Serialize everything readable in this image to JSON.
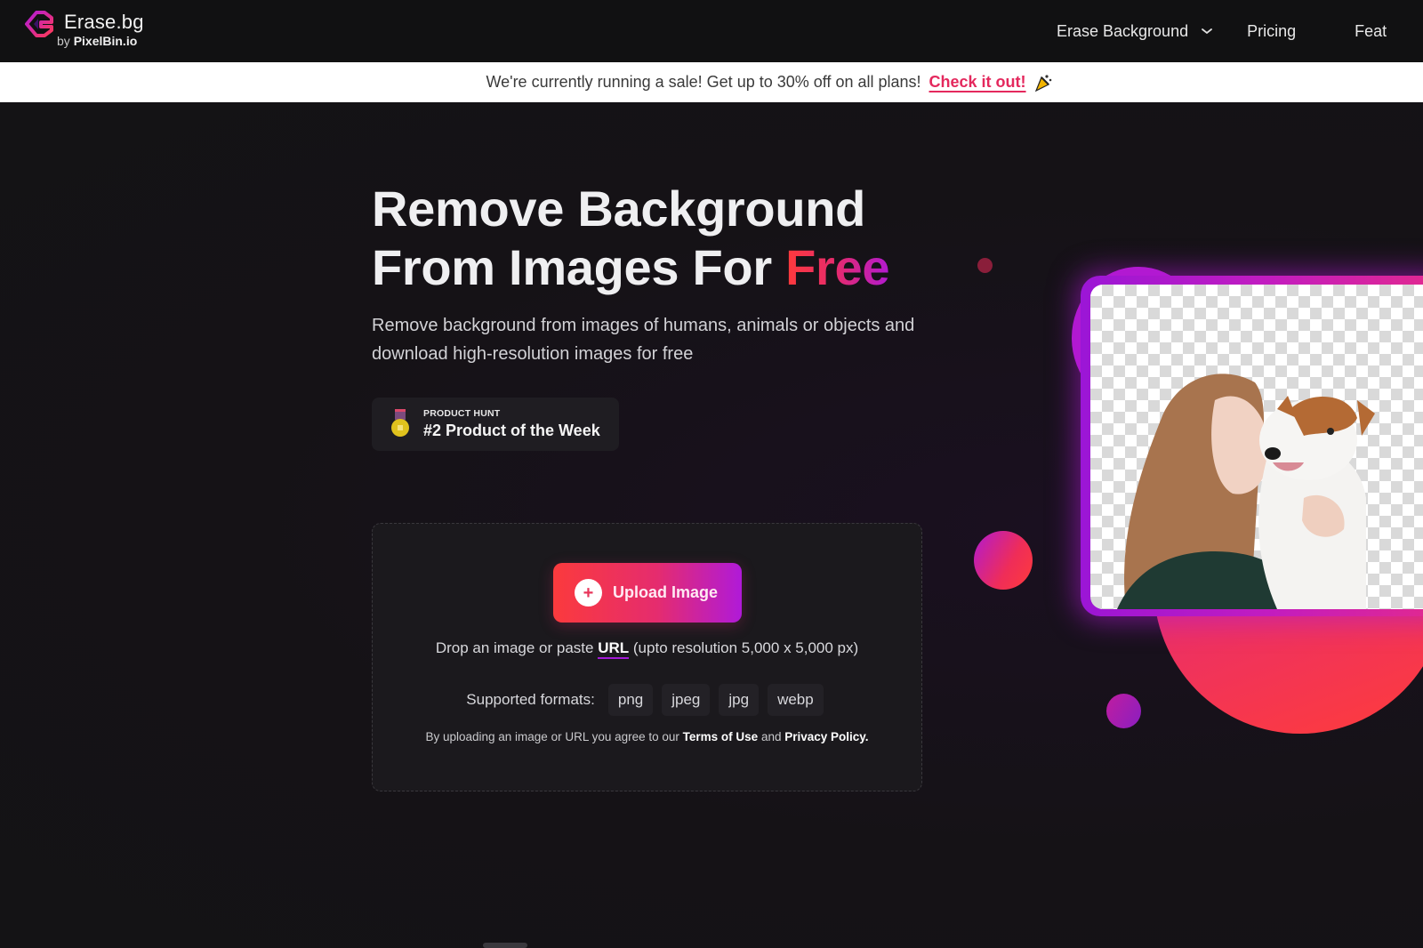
{
  "navbar": {
    "logo": {
      "title": "Erase.bg",
      "by": "by",
      "brand": "PixelBin.io",
      "icon": "erasebg-logo-icon"
    },
    "links": [
      {
        "label": "Erase Background",
        "icon": "chevron-down-icon",
        "has_dropdown": true
      },
      {
        "label": "Pricing"
      },
      {
        "label": "Feat"
      }
    ]
  },
  "sale_banner": {
    "text": "We're currently running a sale! Get up to 30% off on all plans!",
    "link_label": "Check it out!",
    "icon": "party-popper-icon",
    "link_color": "#e4285d"
  },
  "hero": {
    "headline_line1": "Remove Background",
    "headline_line2_prefix": "From Images For ",
    "headline_highlight": "Free",
    "subheading": "Remove background from images of humans, animals or objects and download high-resolution images for free",
    "badge": {
      "icon": "medal-icon",
      "kicker": "PRODUCT HUNT",
      "title": "#2 Product of the Week"
    },
    "example_image": {
      "description": "Woman kissing a Jack Russell terrier with background removed (transparent checkerboard)"
    }
  },
  "upload": {
    "button_label": "Upload Image",
    "button_icon": "plus-circle-icon",
    "drop_text_prefix": "Drop an image or paste ",
    "drop_link": "URL",
    "drop_text_suffix": " (upto resolution 5,000 x 5,000 px)",
    "formats_label": "Supported formats:",
    "formats": [
      "png",
      "jpeg",
      "jpg",
      "webp"
    ],
    "terms_prefix": "By uploading an image or URL you agree to our ",
    "terms_link": "Terms of Use",
    "terms_and": " and ",
    "privacy_link": "Privacy Policy."
  },
  "colors": {
    "accent_start": "#fb3a3d",
    "accent_mid": "#e52c6e",
    "accent_end": "#b01ad8",
    "page_bg": "#151216",
    "navbar_bg": "#111112"
  }
}
